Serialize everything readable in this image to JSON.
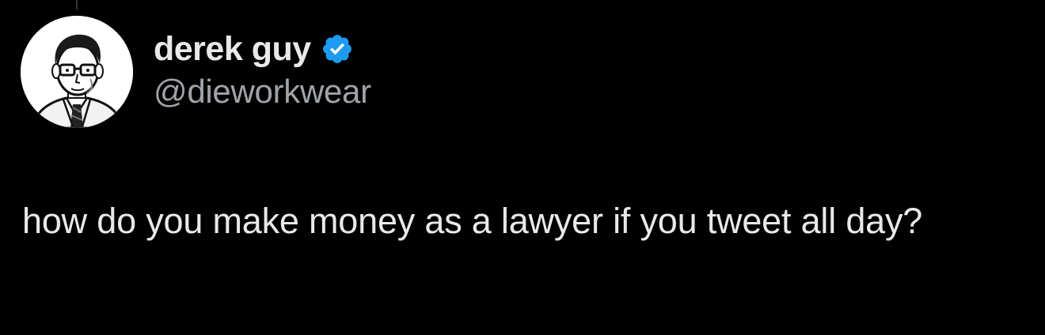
{
  "tweet": {
    "author": {
      "display_name": "derek guy",
      "handle": "@dieworkwear",
      "verified": true,
      "avatar_icon": "illustrated-portrait-avatar"
    },
    "text": "how do you make money as a lawyer if you tweet all day?"
  },
  "colors": {
    "background": "#000000",
    "primary_text": "#e7e9ea",
    "secondary_text": "#a0a4a8",
    "verified_badge": "#1d9bf0"
  }
}
